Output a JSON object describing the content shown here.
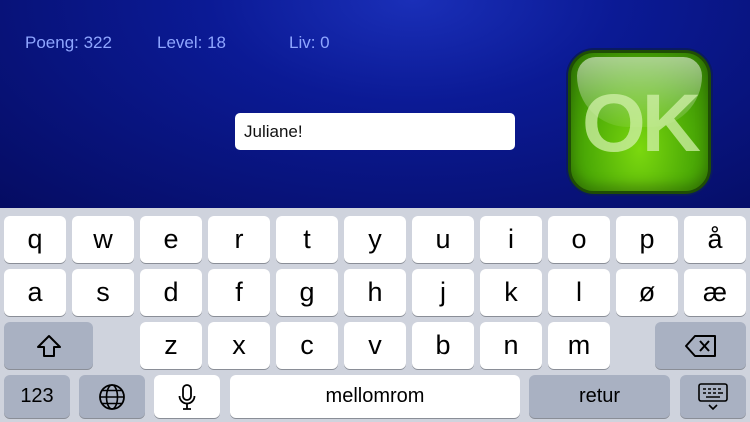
{
  "hud": {
    "score_label": "Poeng: 322",
    "level_label": "Level: 18",
    "lives_label": "Liv: 0"
  },
  "name_input": {
    "value": "Juliane!"
  },
  "ok_button": {
    "label": "OK"
  },
  "keyboard": {
    "row1": [
      "q",
      "w",
      "e",
      "r",
      "t",
      "y",
      "u",
      "i",
      "o",
      "p",
      "å"
    ],
    "row2": [
      "a",
      "s",
      "d",
      "f",
      "g",
      "h",
      "j",
      "k",
      "l",
      "ø",
      "æ"
    ],
    "row3": [
      "z",
      "x",
      "c",
      "v",
      "b",
      "n",
      "m"
    ],
    "numbers_key": "123",
    "space_key": "mellomrom",
    "return_key": "retur",
    "icons": [
      "shift-icon",
      "backspace-icon",
      "globe-icon",
      "microphone-icon",
      "keyboard-dismiss-icon"
    ]
  }
}
